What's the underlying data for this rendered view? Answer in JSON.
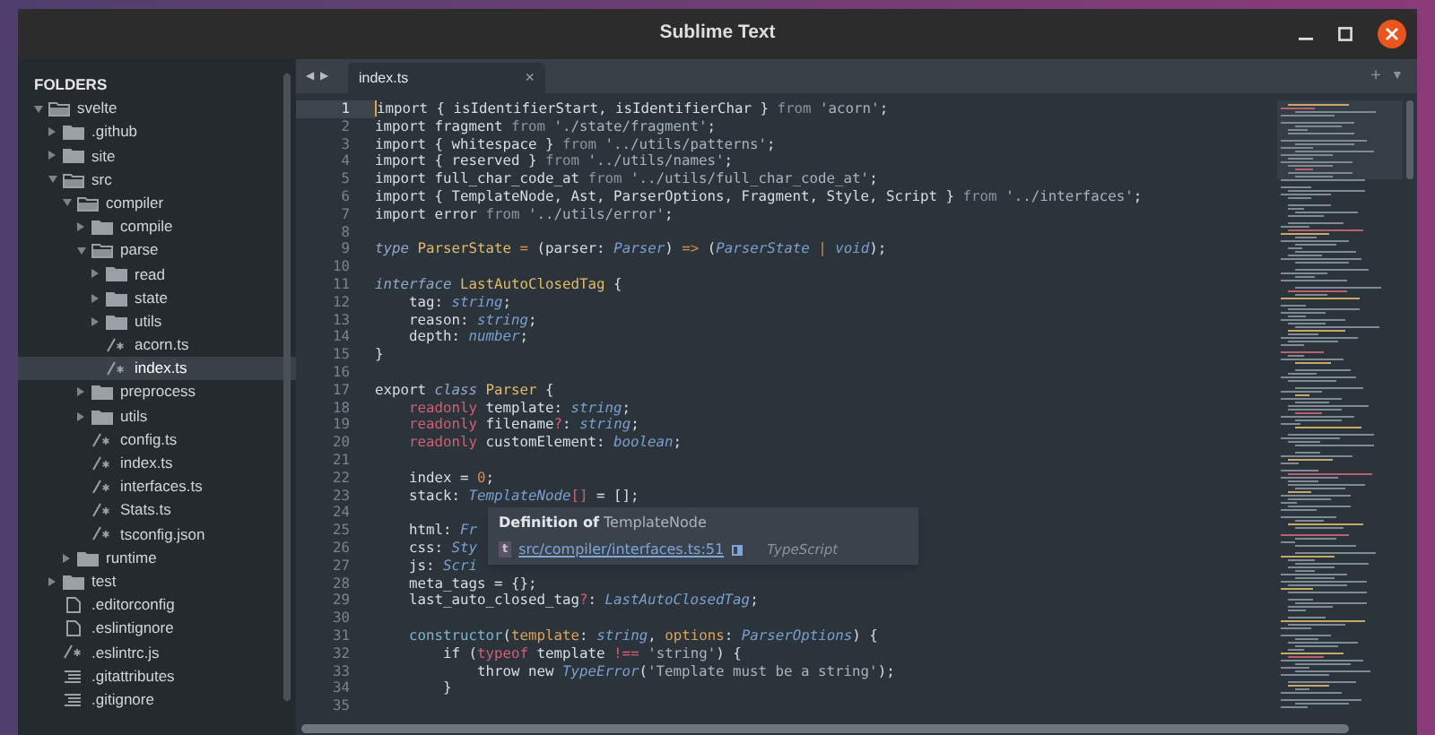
{
  "window": {
    "title": "Sublime Text"
  },
  "sidebar": {
    "heading": "FOLDERS",
    "items": [
      {
        "label": "svelte",
        "kind": "folder",
        "expanded": true,
        "selected": false,
        "children": [
          {
            "label": ".github",
            "kind": "folder",
            "expanded": false,
            "selected": false
          },
          {
            "label": "site",
            "kind": "folder",
            "expanded": false,
            "selected": false
          },
          {
            "label": "src",
            "kind": "folder",
            "expanded": true,
            "selected": false,
            "children": [
              {
                "label": "compiler",
                "kind": "folder",
                "expanded": true,
                "selected": false,
                "children": [
                  {
                    "label": "compile",
                    "kind": "folder",
                    "expanded": false,
                    "selected": false
                  },
                  {
                    "label": "parse",
                    "kind": "folder",
                    "expanded": true,
                    "selected": false,
                    "children": [
                      {
                        "label": "read",
                        "kind": "folder",
                        "expanded": false,
                        "selected": false
                      },
                      {
                        "label": "state",
                        "kind": "folder",
                        "expanded": false,
                        "selected": false
                      },
                      {
                        "label": "utils",
                        "kind": "folder",
                        "expanded": false,
                        "selected": false
                      },
                      {
                        "label": "acorn.ts",
                        "kind": "code",
                        "selected": false
                      },
                      {
                        "label": "index.ts",
                        "kind": "code",
                        "selected": true
                      }
                    ]
                  },
                  {
                    "label": "preprocess",
                    "kind": "folder",
                    "expanded": false,
                    "selected": false
                  },
                  {
                    "label": "utils",
                    "kind": "folder",
                    "expanded": false,
                    "selected": false
                  },
                  {
                    "label": "config.ts",
                    "kind": "code",
                    "selected": false
                  },
                  {
                    "label": "index.ts",
                    "kind": "code",
                    "selected": false
                  },
                  {
                    "label": "interfaces.ts",
                    "kind": "code",
                    "selected": false
                  },
                  {
                    "label": "Stats.ts",
                    "kind": "code",
                    "selected": false
                  },
                  {
                    "label": "tsconfig.json",
                    "kind": "code",
                    "selected": false
                  }
                ]
              },
              {
                "label": "runtime",
                "kind": "folder",
                "expanded": false,
                "selected": false
              }
            ]
          },
          {
            "label": "test",
            "kind": "folder",
            "expanded": false,
            "selected": false
          },
          {
            "label": ".editorconfig",
            "kind": "doc",
            "selected": false
          },
          {
            "label": ".eslintignore",
            "kind": "doc",
            "selected": false
          },
          {
            "label": ".eslintrc.js",
            "kind": "code",
            "selected": false
          },
          {
            "label": ".gitattributes",
            "kind": "lines",
            "selected": false
          },
          {
            "label": ".gitignore",
            "kind": "lines",
            "selected": false
          }
        ]
      }
    ]
  },
  "tabs": {
    "back": "◀",
    "forward": "▶",
    "items": [
      {
        "label": "index.ts",
        "close": "×",
        "selected": true
      }
    ],
    "add": "+",
    "menu": "▼"
  },
  "editor": {
    "lines": [
      {
        "number": "1",
        "current": true,
        "tokens": [
          {
            "text": "import { isIdentifierStart, isIdentifierChar } ",
            "kind": "plain"
          },
          {
            "text": "from ",
            "kind": "from"
          },
          {
            "text": "'acorn'",
            "kind": "str"
          },
          {
            "text": ";",
            "kind": "plain"
          }
        ]
      },
      {
        "number": "2",
        "current": false,
        "tokens": [
          {
            "text": "import fragment ",
            "kind": "plain"
          },
          {
            "text": "from ",
            "kind": "from"
          },
          {
            "text": "'./state/fragment'",
            "kind": "str"
          },
          {
            "text": ";",
            "kind": "plain"
          }
        ]
      },
      {
        "number": "3",
        "current": false,
        "tokens": [
          {
            "text": "import { whitespace } ",
            "kind": "plain"
          },
          {
            "text": "from ",
            "kind": "from"
          },
          {
            "text": "'../utils/patterns'",
            "kind": "str"
          },
          {
            "text": ";",
            "kind": "plain"
          }
        ]
      },
      {
        "number": "4",
        "current": false,
        "tokens": [
          {
            "text": "import { reserved } ",
            "kind": "plain"
          },
          {
            "text": "from ",
            "kind": "from"
          },
          {
            "text": "'../utils/names'",
            "kind": "str"
          },
          {
            "text": ";",
            "kind": "plain"
          }
        ]
      },
      {
        "number": "5",
        "current": false,
        "tokens": [
          {
            "text": "import full_char_code_at ",
            "kind": "plain"
          },
          {
            "text": "from ",
            "kind": "from"
          },
          {
            "text": "'../utils/full_char_code_at'",
            "kind": "str"
          },
          {
            "text": ";",
            "kind": "plain"
          }
        ]
      },
      {
        "number": "6",
        "current": false,
        "tokens": [
          {
            "text": "import { TemplateNode, Ast, ParserOptions, Fragment, Style, Script } ",
            "kind": "plain"
          },
          {
            "text": "from ",
            "kind": "from"
          },
          {
            "text": "'../interfaces'",
            "kind": "str"
          },
          {
            "text": ";",
            "kind": "plain"
          }
        ]
      },
      {
        "number": "7",
        "current": false,
        "tokens": [
          {
            "text": "import error ",
            "kind": "plain"
          },
          {
            "text": "from ",
            "kind": "from"
          },
          {
            "text": "'../utils/error'",
            "kind": "str"
          },
          {
            "text": ";",
            "kind": "plain"
          }
        ]
      },
      {
        "number": "8",
        "current": false
      },
      {
        "number": "9",
        "current": false,
        "tokens": [
          {
            "text": "type ",
            "kind": "ikw"
          },
          {
            "text": "ParserState ",
            "kind": "decl"
          },
          {
            "text": "=",
            "kind": "op"
          },
          {
            "text": " (parser: ",
            "kind": "plain"
          },
          {
            "text": "Parser",
            "kind": "type"
          },
          {
            "text": ") ",
            "kind": "plain"
          },
          {
            "text": "=>",
            "kind": "op"
          },
          {
            "text": " (",
            "kind": "plain"
          },
          {
            "text": "ParserState ",
            "kind": "type"
          },
          {
            "text": "|",
            "kind": "op"
          },
          {
            "text": " void",
            "kind": "type"
          },
          {
            "text": ");",
            "kind": "plain"
          }
        ]
      },
      {
        "number": "10",
        "current": false
      },
      {
        "number": "11",
        "current": false,
        "tokens": [
          {
            "text": "interface ",
            "kind": "ikw"
          },
          {
            "text": "LastAutoClosedTag",
            "kind": "decl"
          },
          {
            "text": " {",
            "kind": "plain"
          }
        ]
      },
      {
        "number": "12",
        "current": false,
        "tokens": [
          {
            "text": "    tag: ",
            "kind": "plain"
          },
          {
            "text": "string",
            "kind": "type"
          },
          {
            "text": ";",
            "kind": "plain"
          }
        ]
      },
      {
        "number": "13",
        "current": false,
        "tokens": [
          {
            "text": "    reason: ",
            "kind": "plain"
          },
          {
            "text": "string",
            "kind": "type"
          },
          {
            "text": ";",
            "kind": "plain"
          }
        ]
      },
      {
        "number": "14",
        "current": false,
        "tokens": [
          {
            "text": "    depth: ",
            "kind": "plain"
          },
          {
            "text": "number",
            "kind": "type"
          },
          {
            "text": ";",
            "kind": "plain"
          }
        ]
      },
      {
        "number": "15",
        "current": false,
        "tokens": [
          {
            "text": "}",
            "kind": "plain"
          }
        ]
      },
      {
        "number": "16",
        "current": false
      },
      {
        "number": "17",
        "current": false,
        "tokens": [
          {
            "text": "export ",
            "kind": "plain"
          },
          {
            "text": "class ",
            "kind": "ikw"
          },
          {
            "text": "Parser",
            "kind": "decl"
          },
          {
            "text": " {",
            "kind": "plain"
          }
        ]
      },
      {
        "number": "18",
        "current": false,
        "tokens": [
          {
            "text": "    readonly",
            "kind": "storage"
          },
          {
            "text": " template: ",
            "kind": "plain"
          },
          {
            "text": "string",
            "kind": "type"
          },
          {
            "text": ";",
            "kind": "plain"
          }
        ]
      },
      {
        "number": "19",
        "current": false,
        "tokens": [
          {
            "text": "    readonly",
            "kind": "storage"
          },
          {
            "text": " filename",
            "kind": "plain"
          },
          {
            "text": "?",
            "kind": "storage"
          },
          {
            "text": ": ",
            "kind": "plain"
          },
          {
            "text": "string",
            "kind": "type"
          },
          {
            "text": ";",
            "kind": "plain"
          }
        ]
      },
      {
        "number": "20",
        "current": false,
        "tokens": [
          {
            "text": "    readonly",
            "kind": "storage"
          },
          {
            "text": " customElement: ",
            "kind": "plain"
          },
          {
            "text": "boolean",
            "kind": "type"
          },
          {
            "text": ";",
            "kind": "plain"
          }
        ]
      },
      {
        "number": "21",
        "current": false
      },
      {
        "number": "22",
        "current": false,
        "tokens": [
          {
            "text": "    index = ",
            "kind": "plain"
          },
          {
            "text": "0",
            "kind": "op"
          },
          {
            "text": ";",
            "kind": "plain"
          }
        ]
      },
      {
        "number": "23",
        "current": false,
        "tokens": [
          {
            "text": "    stack: ",
            "kind": "plain"
          },
          {
            "text": "TemplateNode",
            "kind": "type"
          },
          {
            "text": "[]",
            "kind": "storage"
          },
          {
            "text": " = [];",
            "kind": "plain"
          }
        ]
      },
      {
        "number": "24",
        "current": false
      },
      {
        "number": "25",
        "current": false,
        "tokens": [
          {
            "text": "    html: ",
            "kind": "plain"
          },
          {
            "text": "Fr",
            "kind": "type"
          }
        ]
      },
      {
        "number": "26",
        "current": false,
        "tokens": [
          {
            "text": "    css: ",
            "kind": "plain"
          },
          {
            "text": "Sty",
            "kind": "type"
          }
        ]
      },
      {
        "number": "27",
        "current": false,
        "tokens": [
          {
            "text": "    js: ",
            "kind": "plain"
          },
          {
            "text": "Scri",
            "kind": "type"
          }
        ]
      },
      {
        "number": "28",
        "current": false,
        "tokens": [
          {
            "text": "    meta_tags = {};",
            "kind": "plain"
          }
        ]
      },
      {
        "number": "29",
        "current": false,
        "tokens": [
          {
            "text": "    last_auto_closed_tag",
            "kind": "plain"
          },
          {
            "text": "?",
            "kind": "storage"
          },
          {
            "text": ": ",
            "kind": "plain"
          },
          {
            "text": "LastAutoClosedTag",
            "kind": "type"
          },
          {
            "text": ";",
            "kind": "plain"
          }
        ]
      },
      {
        "number": "30",
        "current": false
      },
      {
        "number": "31",
        "current": false,
        "tokens": [
          {
            "text": "    constructor",
            "kind": "fn"
          },
          {
            "text": "(",
            "kind": "plain"
          },
          {
            "text": "template",
            "kind": "param"
          },
          {
            "text": ": ",
            "kind": "plain"
          },
          {
            "text": "string",
            "kind": "type"
          },
          {
            "text": ", ",
            "kind": "plain"
          },
          {
            "text": "options",
            "kind": "param"
          },
          {
            "text": ": ",
            "kind": "plain"
          },
          {
            "text": "ParserOptions",
            "kind": "type"
          },
          {
            "text": ") {",
            "kind": "plain"
          }
        ]
      },
      {
        "number": "32",
        "current": false,
        "tokens": [
          {
            "text": "        if (",
            "kind": "plain"
          },
          {
            "text": "typeof",
            "kind": "storage"
          },
          {
            "text": " template ",
            "kind": "plain"
          },
          {
            "text": "!==",
            "kind": "storage"
          },
          {
            "text": " 'string'",
            "kind": "str"
          },
          {
            "text": ") {",
            "kind": "plain"
          }
        ]
      },
      {
        "number": "33",
        "current": false,
        "tokens": [
          {
            "text": "            throw new ",
            "kind": "plain"
          },
          {
            "text": "TypeError",
            "kind": "type"
          },
          {
            "text": "(",
            "kind": "plain"
          },
          {
            "text": "'Template must be a string'",
            "kind": "str"
          },
          {
            "text": ");",
            "kind": "plain"
          }
        ]
      },
      {
        "number": "34",
        "current": false,
        "tokens": [
          {
            "text": "        }",
            "kind": "plain"
          }
        ]
      },
      {
        "number": "35",
        "current": false
      }
    ]
  },
  "popup": {
    "title": "Definition of",
    "symbol": "TemplateNode",
    "badge": "t",
    "link": "src/compiler/interfaces.ts:51",
    "language": "TypeScript"
  }
}
